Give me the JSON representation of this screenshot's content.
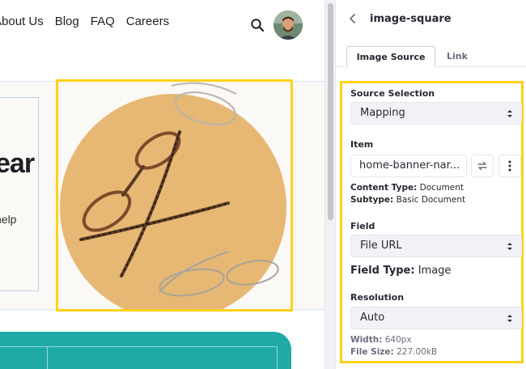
{
  "nav": {
    "items": [
      "About Us",
      "Blog",
      "FAQ",
      "Careers"
    ]
  },
  "hero": {
    "heading_fragment": "ear",
    "subtext_fragment": "help"
  },
  "sidebar": {
    "title": "image-square",
    "tabs": [
      {
        "label": "Image Source",
        "active": true
      },
      {
        "label": "Link",
        "active": false
      }
    ],
    "source_selection": {
      "label": "Source Selection",
      "value": "Mapping"
    },
    "item": {
      "label": "Item",
      "value": "home-banner-nar...",
      "content_type_label": "Content Type:",
      "content_type_value": "Document",
      "subtype_label": "Subtype:",
      "subtype_value": "Basic Document"
    },
    "field": {
      "label": "Field",
      "value": "File URL",
      "type_label": "Field Type:",
      "type_value": "Image"
    },
    "resolution": {
      "label": "Resolution",
      "value": "Auto",
      "width_label": "Width:",
      "width_value": "640px",
      "size_label": "File Size:",
      "size_value": "227.00kB"
    }
  },
  "colors": {
    "selection_outline": "#ffd11a",
    "image_circle": "#e6b874",
    "teal_section": "#1faaa7"
  },
  "icons": [
    "search-icon",
    "avatar",
    "chevron-left-icon",
    "caret-updown-icon",
    "swap-icon",
    "vertical-ellipsis-icon"
  ]
}
